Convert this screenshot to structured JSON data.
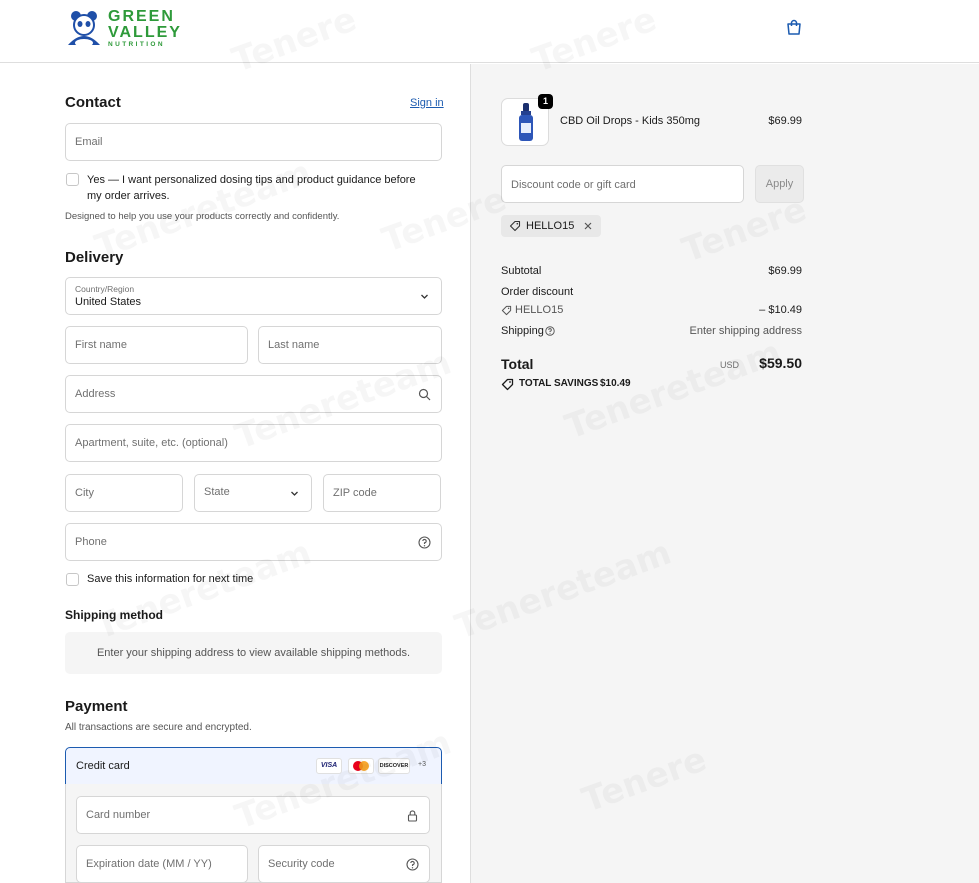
{
  "brand": {
    "line1": "GREEN",
    "line2": "VALLEY",
    "line3": "NUTRITION"
  },
  "contact": {
    "title": "Contact",
    "sign_in": "Sign in",
    "email_placeholder": "Email",
    "opt_in_text": "Yes — I want personalized dosing tips and product guidance before my order arrives.",
    "helper": "Designed to help you use your products correctly and confidently."
  },
  "delivery": {
    "title": "Delivery",
    "country_label": "Country/Region",
    "country_value": "United States",
    "first_name": "First name",
    "last_name": "Last name",
    "address": "Address",
    "apartment": "Apartment, suite, etc. (optional)",
    "city": "City",
    "state": "State",
    "zip": "ZIP code",
    "phone": "Phone",
    "save_info": "Save this information for next time"
  },
  "shipping_method": {
    "title": "Shipping method",
    "message": "Enter your shipping address to view available shipping methods."
  },
  "payment": {
    "title": "Payment",
    "subtitle": "All transactions are secure and encrypted.",
    "credit_card": "Credit card",
    "card_badges": [
      "VISA",
      "DISCOVER",
      "+3"
    ],
    "card_number": "Card number",
    "expiration": "Expiration date (MM / YY)",
    "security_code": "Security code"
  },
  "order": {
    "item_name": "CBD Oil Drops - Kids 350mg",
    "item_price": "$69.99",
    "quantity": "1",
    "discount_placeholder": "Discount code or gift card",
    "apply": "Apply",
    "applied_code": "HELLO15",
    "subtotal_label": "Subtotal",
    "subtotal_value": "$69.99",
    "order_discount_label": "Order discount",
    "discount_code": "HELLO15",
    "discount_value": "– $10.49",
    "shipping_label": "Shipping",
    "shipping_value": "Enter shipping address",
    "total_label": "Total",
    "currency": "USD",
    "total_value": "$59.50",
    "savings_label": "TOTAL SAVINGS",
    "savings_value": "$10.49"
  },
  "colors": {
    "brand_green": "#2e9a3a",
    "link_blue": "#1c5bb0",
    "panel_bg": "#f5f5f5"
  }
}
